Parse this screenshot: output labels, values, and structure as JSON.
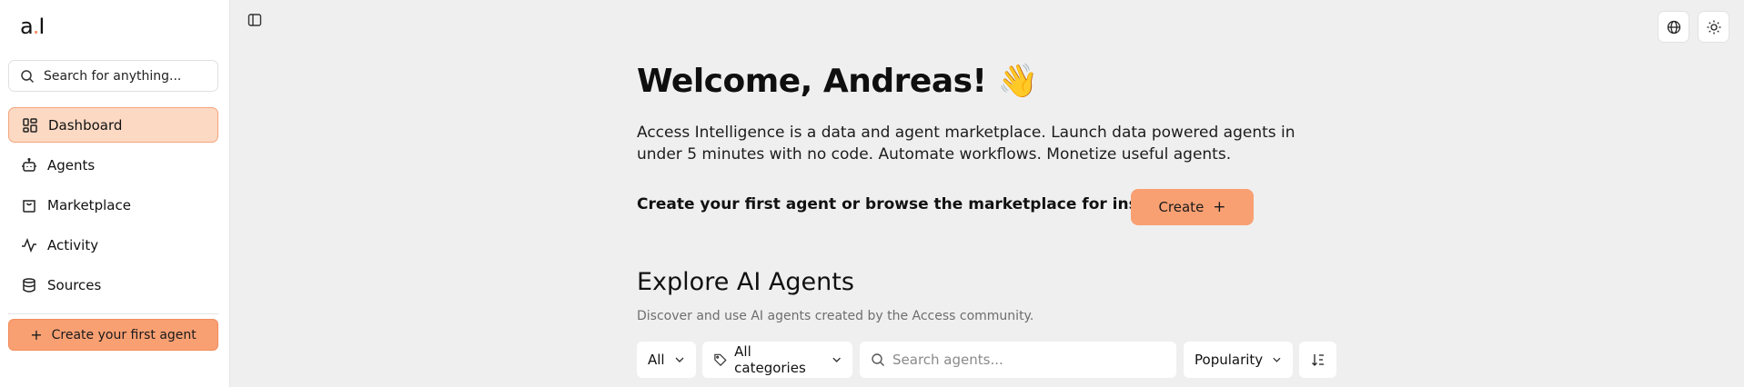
{
  "app": {
    "logo_main": "a",
    "logo_dot": ".",
    "logo_end": "I"
  },
  "sidebar": {
    "search_placeholder": "Search for anything...",
    "items": [
      {
        "label": "Dashboard",
        "icon": "dashboard-icon",
        "active": true
      },
      {
        "label": "Agents",
        "icon": "robot-icon"
      },
      {
        "label": "Marketplace",
        "icon": "shopping-bag-icon"
      },
      {
        "label": "Activity",
        "icon": "activity-icon"
      },
      {
        "label": "Sources",
        "icon": "database-icon"
      }
    ],
    "create_label": "Create your first agent"
  },
  "main": {
    "welcome": "Welcome, Andreas! 👋",
    "intro": "Access Intelligence is a data and agent marketplace. Launch data powered agents in under 5 minutes with no code. Automate workflows. Monetize useful agents.",
    "cta_text": "Create your first agent or browse the marketplace for inspiration.",
    "create_label": "Create",
    "explore_title": "Explore AI Agents",
    "explore_sub": "Discover and use AI agents created by the Access community.",
    "filters": {
      "type": "All",
      "category": "All categories",
      "search_placeholder": "Search agents...",
      "sort": "Popularity"
    }
  },
  "colors": {
    "accent": "#f9a073",
    "active_bg": "#fcd9c3",
    "background": "#efefef"
  }
}
